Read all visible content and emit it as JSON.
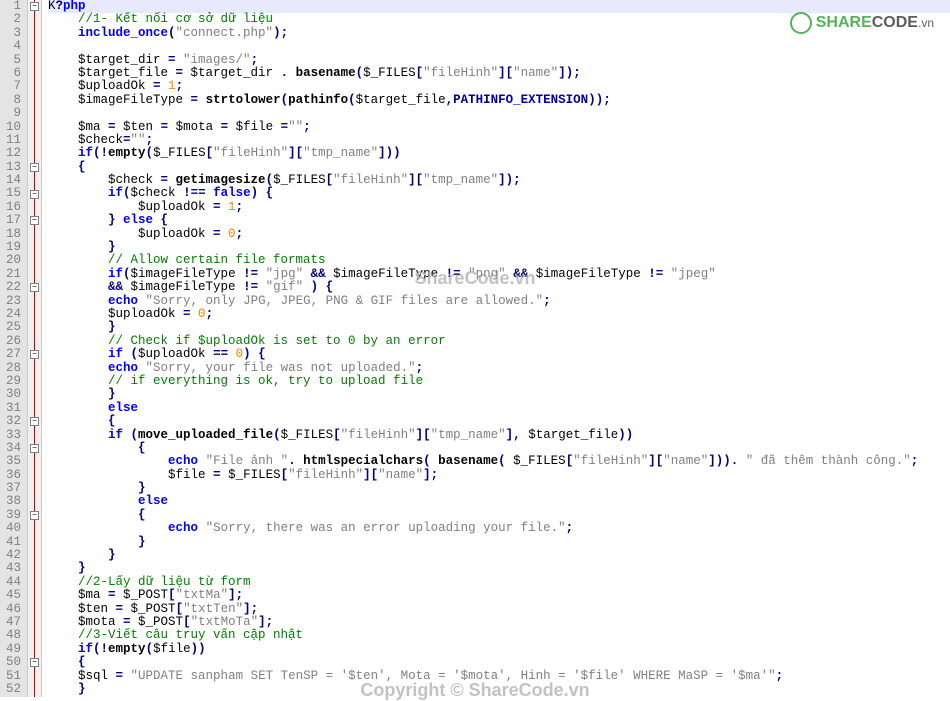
{
  "watermark": {
    "logo_share": "SHARE",
    "logo_code": "CODE",
    "logo_tld": ".vn",
    "center1": "ShareCode.vn",
    "center2": "Copyright © ShareCode.vn"
  },
  "highlighted_line": 1,
  "lines": [
    {
      "n": 1,
      "fold": "minus",
      "indent": 0,
      "tokens": [
        {
          "t": "K",
          "c": "plain"
        },
        {
          "t": "?",
          "c": "punct"
        },
        {
          "t": "php",
          "c": "kw"
        }
      ]
    },
    {
      "n": 2,
      "indent": 1,
      "tokens": [
        {
          "t": "//1- Kết nối cơ sở dữ liệu",
          "c": "comment"
        }
      ]
    },
    {
      "n": 3,
      "indent": 1,
      "tokens": [
        {
          "t": "include_once",
          "c": "kw"
        },
        {
          "t": "(",
          "c": "punct"
        },
        {
          "t": "\"connect.php\"",
          "c": "str"
        },
        {
          "t": ");",
          "c": "punct"
        }
      ]
    },
    {
      "n": 4,
      "indent": 1,
      "tokens": []
    },
    {
      "n": 5,
      "indent": 1,
      "tokens": [
        {
          "t": "$target_dir",
          "c": "var"
        },
        {
          "t": " = ",
          "c": "op"
        },
        {
          "t": "\"images/\"",
          "c": "str"
        },
        {
          "t": ";",
          "c": "punct"
        }
      ]
    },
    {
      "n": 6,
      "indent": 1,
      "tokens": [
        {
          "t": "$target_file",
          "c": "var"
        },
        {
          "t": " = ",
          "c": "op"
        },
        {
          "t": "$target_dir",
          "c": "var"
        },
        {
          "t": " . ",
          "c": "op"
        },
        {
          "t": "basename",
          "c": "func"
        },
        {
          "t": "(",
          "c": "punct"
        },
        {
          "t": "$_FILES",
          "c": "var"
        },
        {
          "t": "[",
          "c": "punct"
        },
        {
          "t": "\"fileHinh\"",
          "c": "str"
        },
        {
          "t": "][",
          "c": "punct"
        },
        {
          "t": "\"name\"",
          "c": "str"
        },
        {
          "t": "]);",
          "c": "punct"
        }
      ]
    },
    {
      "n": 7,
      "indent": 1,
      "tokens": [
        {
          "t": "$uploadOk",
          "c": "var"
        },
        {
          "t": " = ",
          "c": "op"
        },
        {
          "t": "1",
          "c": "num"
        },
        {
          "t": ";",
          "c": "punct"
        }
      ]
    },
    {
      "n": 8,
      "indent": 1,
      "tokens": [
        {
          "t": "$imageFileType",
          "c": "var"
        },
        {
          "t": " = ",
          "c": "op"
        },
        {
          "t": "strtolower",
          "c": "func"
        },
        {
          "t": "(",
          "c": "punct"
        },
        {
          "t": "pathinfo",
          "c": "func"
        },
        {
          "t": "(",
          "c": "punct"
        },
        {
          "t": "$target_file",
          "c": "var"
        },
        {
          "t": ",",
          "c": "punct"
        },
        {
          "t": "PATHINFO_EXTENSION",
          "c": "const"
        },
        {
          "t": "));",
          "c": "punct"
        }
      ]
    },
    {
      "n": 9,
      "indent": 1,
      "tokens": []
    },
    {
      "n": 10,
      "indent": 1,
      "tokens": [
        {
          "t": "$ma",
          "c": "var"
        },
        {
          "t": " = ",
          "c": "op"
        },
        {
          "t": "$ten",
          "c": "var"
        },
        {
          "t": " = ",
          "c": "op"
        },
        {
          "t": "$mota",
          "c": "var"
        },
        {
          "t": " = ",
          "c": "op"
        },
        {
          "t": "$file",
          "c": "var"
        },
        {
          "t": " =",
          "c": "op"
        },
        {
          "t": "\"\"",
          "c": "str"
        },
        {
          "t": ";",
          "c": "punct"
        }
      ]
    },
    {
      "n": 11,
      "indent": 1,
      "tokens": [
        {
          "t": "$check",
          "c": "var"
        },
        {
          "t": "=",
          "c": "op"
        },
        {
          "t": "\"\"",
          "c": "str"
        },
        {
          "t": ";",
          "c": "punct"
        }
      ]
    },
    {
      "n": 12,
      "indent": 1,
      "tokens": [
        {
          "t": "if",
          "c": "kw"
        },
        {
          "t": "(!",
          "c": "punct"
        },
        {
          "t": "empty",
          "c": "func"
        },
        {
          "t": "(",
          "c": "punct"
        },
        {
          "t": "$_FILES",
          "c": "var"
        },
        {
          "t": "[",
          "c": "punct"
        },
        {
          "t": "\"fileHinh\"",
          "c": "str"
        },
        {
          "t": "][",
          "c": "punct"
        },
        {
          "t": "\"tmp_name\"",
          "c": "str"
        },
        {
          "t": "]))",
          "c": "punct"
        }
      ]
    },
    {
      "n": 13,
      "fold": "minus",
      "indent": 1,
      "tokens": [
        {
          "t": "{",
          "c": "punct"
        }
      ]
    },
    {
      "n": 14,
      "indent": 2,
      "tokens": [
        {
          "t": "$check",
          "c": "var"
        },
        {
          "t": " = ",
          "c": "op"
        },
        {
          "t": "getimagesize",
          "c": "func"
        },
        {
          "t": "(",
          "c": "punct"
        },
        {
          "t": "$_FILES",
          "c": "var"
        },
        {
          "t": "[",
          "c": "punct"
        },
        {
          "t": "\"fileHinh\"",
          "c": "str"
        },
        {
          "t": "][",
          "c": "punct"
        },
        {
          "t": "\"tmp_name\"",
          "c": "str"
        },
        {
          "t": "]);",
          "c": "punct"
        }
      ]
    },
    {
      "n": 15,
      "fold": "minus",
      "indent": 2,
      "tokens": [
        {
          "t": "if",
          "c": "kw"
        },
        {
          "t": "(",
          "c": "punct"
        },
        {
          "t": "$check",
          "c": "var"
        },
        {
          "t": " !== ",
          "c": "op"
        },
        {
          "t": "false",
          "c": "kw"
        },
        {
          "t": ") {",
          "c": "punct"
        }
      ]
    },
    {
      "n": 16,
      "indent": 3,
      "tokens": [
        {
          "t": "$uploadOk",
          "c": "var"
        },
        {
          "t": " = ",
          "c": "op"
        },
        {
          "t": "1",
          "c": "num"
        },
        {
          "t": ";",
          "c": "punct"
        }
      ]
    },
    {
      "n": 17,
      "fold": "minus",
      "indent": 2,
      "tokens": [
        {
          "t": "} ",
          "c": "punct"
        },
        {
          "t": "else",
          "c": "kw"
        },
        {
          "t": " {",
          "c": "punct"
        }
      ]
    },
    {
      "n": 18,
      "indent": 3,
      "tokens": [
        {
          "t": "$uploadOk",
          "c": "var"
        },
        {
          "t": " = ",
          "c": "op"
        },
        {
          "t": "0",
          "c": "num"
        },
        {
          "t": ";",
          "c": "punct"
        }
      ]
    },
    {
      "n": 19,
      "indent": 2,
      "tokens": [
        {
          "t": "}",
          "c": "punct"
        }
      ]
    },
    {
      "n": 20,
      "indent": 2,
      "tokens": [
        {
          "t": "// Allow certain file formats",
          "c": "comment"
        }
      ]
    },
    {
      "n": 21,
      "indent": 2,
      "tokens": [
        {
          "t": "if",
          "c": "kw"
        },
        {
          "t": "(",
          "c": "punct"
        },
        {
          "t": "$imageFileType",
          "c": "var"
        },
        {
          "t": " != ",
          "c": "op"
        },
        {
          "t": "\"jpg\"",
          "c": "str"
        },
        {
          "t": " && ",
          "c": "op"
        },
        {
          "t": "$imageFileType",
          "c": "var"
        },
        {
          "t": " != ",
          "c": "op"
        },
        {
          "t": "\"png\"",
          "c": "str"
        },
        {
          "t": " && ",
          "c": "op"
        },
        {
          "t": "$imageFileType",
          "c": "var"
        },
        {
          "t": " != ",
          "c": "op"
        },
        {
          "t": "\"jpeg\"",
          "c": "str"
        }
      ]
    },
    {
      "n": 22,
      "fold": "minus",
      "indent": 2,
      "tokens": [
        {
          "t": "&& ",
          "c": "op"
        },
        {
          "t": "$imageFileType",
          "c": "var"
        },
        {
          "t": " != ",
          "c": "op"
        },
        {
          "t": "\"gif\"",
          "c": "str"
        },
        {
          "t": " ) {",
          "c": "punct"
        }
      ]
    },
    {
      "n": 23,
      "indent": 2,
      "tokens": [
        {
          "t": "echo",
          "c": "kw"
        },
        {
          "t": " ",
          "c": "plain"
        },
        {
          "t": "\"Sorry, only JPG, JPEG, PNG & GIF files are allowed.\"",
          "c": "str"
        },
        {
          "t": ";",
          "c": "punct"
        }
      ]
    },
    {
      "n": 24,
      "indent": 2,
      "tokens": [
        {
          "t": "$uploadOk",
          "c": "var"
        },
        {
          "t": " = ",
          "c": "op"
        },
        {
          "t": "0",
          "c": "num"
        },
        {
          "t": ";",
          "c": "punct"
        }
      ]
    },
    {
      "n": 25,
      "indent": 2,
      "tokens": [
        {
          "t": "}",
          "c": "punct"
        }
      ]
    },
    {
      "n": 26,
      "indent": 2,
      "tokens": [
        {
          "t": "// Check if $uploadOk is set to 0 by an error",
          "c": "comment"
        }
      ]
    },
    {
      "n": 27,
      "fold": "minus",
      "indent": 2,
      "tokens": [
        {
          "t": "if",
          "c": "kw"
        },
        {
          "t": " (",
          "c": "punct"
        },
        {
          "t": "$uploadOk",
          "c": "var"
        },
        {
          "t": " == ",
          "c": "op"
        },
        {
          "t": "0",
          "c": "num"
        },
        {
          "t": ") {",
          "c": "punct"
        }
      ]
    },
    {
      "n": 28,
      "indent": 2,
      "tokens": [
        {
          "t": "echo",
          "c": "kw"
        },
        {
          "t": " ",
          "c": "plain"
        },
        {
          "t": "\"Sorry, your file was not uploaded.\"",
          "c": "str"
        },
        {
          "t": ";",
          "c": "punct"
        }
      ]
    },
    {
      "n": 29,
      "indent": 2,
      "tokens": [
        {
          "t": "// if everything is ok, try to upload file",
          "c": "comment"
        }
      ]
    },
    {
      "n": 30,
      "indent": 2,
      "tokens": [
        {
          "t": "}",
          "c": "punct"
        }
      ]
    },
    {
      "n": 31,
      "indent": 2,
      "tokens": [
        {
          "t": "else",
          "c": "kw"
        }
      ]
    },
    {
      "n": 32,
      "fold": "minus",
      "indent": 2,
      "tokens": [
        {
          "t": "{",
          "c": "punct"
        }
      ]
    },
    {
      "n": 33,
      "indent": 2,
      "tokens": [
        {
          "t": "if",
          "c": "kw"
        },
        {
          "t": " (",
          "c": "punct"
        },
        {
          "t": "move_uploaded_file",
          "c": "func"
        },
        {
          "t": "(",
          "c": "punct"
        },
        {
          "t": "$_FILES",
          "c": "var"
        },
        {
          "t": "[",
          "c": "punct"
        },
        {
          "t": "\"fileHinh\"",
          "c": "str"
        },
        {
          "t": "][",
          "c": "punct"
        },
        {
          "t": "\"tmp_name\"",
          "c": "str"
        },
        {
          "t": "], ",
          "c": "punct"
        },
        {
          "t": "$target_file",
          "c": "var"
        },
        {
          "t": "))",
          "c": "punct"
        }
      ]
    },
    {
      "n": 34,
      "fold": "minus",
      "indent": 3,
      "tokens": [
        {
          "t": "{",
          "c": "punct"
        }
      ]
    },
    {
      "n": 35,
      "indent": 4,
      "tokens": [
        {
          "t": "echo",
          "c": "kw"
        },
        {
          "t": " ",
          "c": "plain"
        },
        {
          "t": "\"File ảnh \"",
          "c": "str"
        },
        {
          "t": ". ",
          "c": "op"
        },
        {
          "t": "htmlspecialchars",
          "c": "func"
        },
        {
          "t": "( ",
          "c": "punct"
        },
        {
          "t": "basename",
          "c": "func"
        },
        {
          "t": "( ",
          "c": "punct"
        },
        {
          "t": "$_FILES",
          "c": "var"
        },
        {
          "t": "[",
          "c": "punct"
        },
        {
          "t": "\"fileHinh\"",
          "c": "str"
        },
        {
          "t": "][",
          "c": "punct"
        },
        {
          "t": "\"name\"",
          "c": "str"
        },
        {
          "t": "])). ",
          "c": "punct"
        },
        {
          "t": "\" đã thêm thành công.\"",
          "c": "str"
        },
        {
          "t": ";",
          "c": "punct"
        }
      ]
    },
    {
      "n": 36,
      "indent": 4,
      "tokens": [
        {
          "t": "$file",
          "c": "var"
        },
        {
          "t": " = ",
          "c": "op"
        },
        {
          "t": "$_FILES",
          "c": "var"
        },
        {
          "t": "[",
          "c": "punct"
        },
        {
          "t": "\"fileHinh\"",
          "c": "str"
        },
        {
          "t": "][",
          "c": "punct"
        },
        {
          "t": "\"name\"",
          "c": "str"
        },
        {
          "t": "];",
          "c": "punct"
        }
      ]
    },
    {
      "n": 37,
      "indent": 3,
      "tokens": [
        {
          "t": "}",
          "c": "punct"
        }
      ]
    },
    {
      "n": 38,
      "indent": 3,
      "tokens": [
        {
          "t": "else",
          "c": "kw"
        }
      ]
    },
    {
      "n": 39,
      "fold": "minus",
      "indent": 3,
      "tokens": [
        {
          "t": "{",
          "c": "punct"
        }
      ]
    },
    {
      "n": 40,
      "indent": 4,
      "tokens": [
        {
          "t": "echo",
          "c": "kw"
        },
        {
          "t": " ",
          "c": "plain"
        },
        {
          "t": "\"Sorry, there was an error uploading your file.\"",
          "c": "str"
        },
        {
          "t": ";",
          "c": "punct"
        }
      ]
    },
    {
      "n": 41,
      "indent": 3,
      "tokens": [
        {
          "t": "}",
          "c": "punct"
        }
      ]
    },
    {
      "n": 42,
      "indent": 2,
      "tokens": [
        {
          "t": "}",
          "c": "punct"
        }
      ]
    },
    {
      "n": 43,
      "indent": 1,
      "tokens": [
        {
          "t": "}",
          "c": "punct"
        }
      ]
    },
    {
      "n": 44,
      "indent": 1,
      "tokens": [
        {
          "t": "//2-Lấy dữ liệu từ form",
          "c": "comment"
        }
      ]
    },
    {
      "n": 45,
      "indent": 1,
      "tokens": [
        {
          "t": "$ma",
          "c": "var"
        },
        {
          "t": " = ",
          "c": "op"
        },
        {
          "t": "$_POST",
          "c": "var"
        },
        {
          "t": "[",
          "c": "punct"
        },
        {
          "t": "\"txtMa\"",
          "c": "str"
        },
        {
          "t": "];",
          "c": "punct"
        }
      ]
    },
    {
      "n": 46,
      "indent": 1,
      "tokens": [
        {
          "t": "$ten",
          "c": "var"
        },
        {
          "t": " = ",
          "c": "op"
        },
        {
          "t": "$_POST",
          "c": "var"
        },
        {
          "t": "[",
          "c": "punct"
        },
        {
          "t": "\"txtTen\"",
          "c": "str"
        },
        {
          "t": "];",
          "c": "punct"
        }
      ]
    },
    {
      "n": 47,
      "indent": 1,
      "tokens": [
        {
          "t": "$mota",
          "c": "var"
        },
        {
          "t": " = ",
          "c": "op"
        },
        {
          "t": "$_POST",
          "c": "var"
        },
        {
          "t": "[",
          "c": "punct"
        },
        {
          "t": "\"txtMoTa\"",
          "c": "str"
        },
        {
          "t": "];",
          "c": "punct"
        }
      ]
    },
    {
      "n": 48,
      "indent": 1,
      "tokens": [
        {
          "t": "//3-Viết câu truy vấn cập nhật",
          "c": "comment"
        }
      ]
    },
    {
      "n": 49,
      "indent": 1,
      "tokens": [
        {
          "t": "if",
          "c": "kw"
        },
        {
          "t": "(!",
          "c": "punct"
        },
        {
          "t": "empty",
          "c": "func"
        },
        {
          "t": "(",
          "c": "punct"
        },
        {
          "t": "$file",
          "c": "var"
        },
        {
          "t": "))",
          "c": "punct"
        }
      ]
    },
    {
      "n": 50,
      "fold": "minus",
      "indent": 1,
      "tokens": [
        {
          "t": "{",
          "c": "punct"
        }
      ]
    },
    {
      "n": 51,
      "indent": 1,
      "tokens": [
        {
          "t": "$sql",
          "c": "var"
        },
        {
          "t": " = ",
          "c": "op"
        },
        {
          "t": "\"UPDATE sanpham SET TenSP = '$ten', Mota = '$mota', Hinh = '$file' WHERE MaSP = '$ma'\"",
          "c": "str"
        },
        {
          "t": ";",
          "c": "punct"
        }
      ]
    },
    {
      "n": 52,
      "indent": 1,
      "tokens": [
        {
          "t": "}",
          "c": "punct"
        }
      ]
    }
  ]
}
